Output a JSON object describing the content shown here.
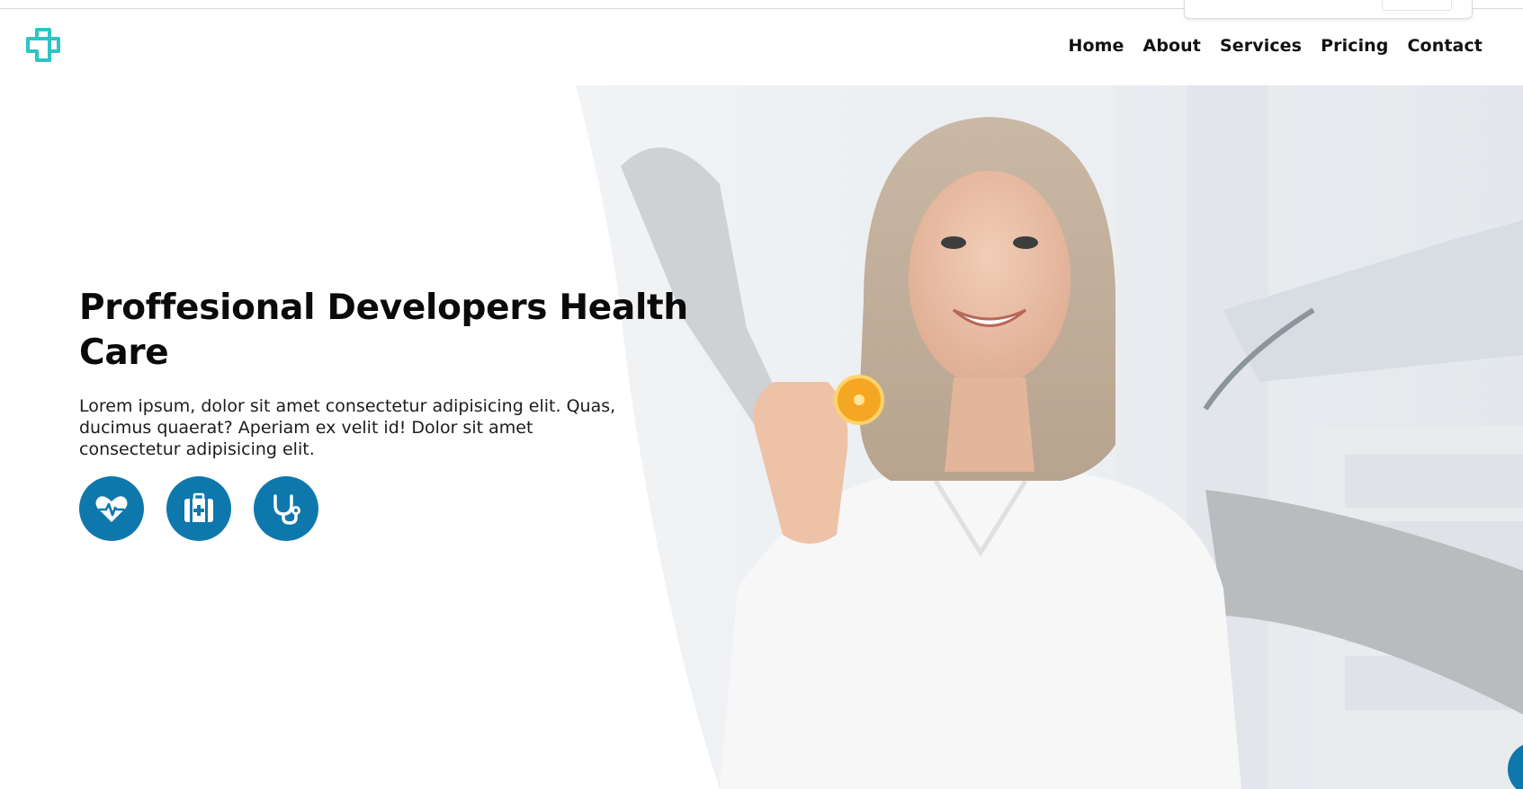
{
  "header": {
    "logo_icon": "medical-cross-icon",
    "nav": [
      {
        "label": "Home"
      },
      {
        "label": "About"
      },
      {
        "label": "Services"
      },
      {
        "label": "Pricing"
      },
      {
        "label": "Contact"
      }
    ]
  },
  "hero": {
    "title": "Proffesional Developers Health Care",
    "description": "Lorem ipsum, dolor sit amet consectetur adipisicing elit. Quas, ducimus quaerat? Aperiam ex velit id! Dolor sit amet consectetur adipisicing elit.",
    "image": "smiling-woman-dental-clinic",
    "icons": [
      "heartbeat-icon",
      "first-aid-kit-icon",
      "stethoscope-icon"
    ]
  },
  "colors": {
    "accent": "#0e78ad",
    "logo": "#2fc4c4",
    "text": "#0a0a0a"
  }
}
